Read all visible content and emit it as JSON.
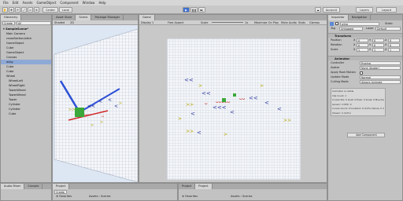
{
  "menu": [
    "File",
    "Edit",
    "Assets",
    "GameObject",
    "Component",
    "Window",
    "Help"
  ],
  "toolbar": {
    "center": "Center",
    "local": "Local",
    "account": "Account",
    "layers": "Layers",
    "layout": "Layout"
  },
  "hierarchy": {
    "tab": "Hierarchy",
    "create": "Create",
    "search_placeholder": "All",
    "scene": "SampleScene*",
    "items": [
      "Main Camera",
      "crossSection/stick",
      "GameObject",
      "Cube",
      "GameObject",
      "Canvas",
      "wing",
      "Cube",
      "Cube",
      "Wheel",
      "WheelLeft",
      "WheelRight",
      "TowerWheel",
      "TowerWheel",
      "Tower",
      "Cylinder",
      "Cylinder",
      "Cube"
    ],
    "selected_index": 6
  },
  "scene_tabs": [
    "Asset Store",
    "Scene",
    "Package Manager"
  ],
  "scene_toolbar": {
    "shading": "Shaded",
    "mode": "2D"
  },
  "game": {
    "tab": "Game",
    "display": "Display 1",
    "aspect": "Free Aspect",
    "scale_label": "Scale",
    "scale_value": "1x",
    "buttons": [
      "Maximize On Play",
      "Mute Audio",
      "Stats",
      "Gizmos"
    ]
  },
  "inspector": {
    "tabs": [
      "Inspector",
      "Navigation"
    ],
    "object_name": "wing",
    "static_label": "Static",
    "tag_label": "Tag",
    "tag_value": "Untagged",
    "layer_label": "Layer",
    "layer_value": "Default",
    "transform": {
      "title": "Transform",
      "rows": [
        {
          "label": "Position",
          "x": "0",
          "y": "0",
          "z": "0"
        },
        {
          "label": "Rotation",
          "x": "0",
          "y": "0",
          "z": "0"
        },
        {
          "label": "Scale",
          "x": "1",
          "y": "1",
          "z": "1"
        }
      ]
    },
    "animator": {
      "title": "Animator",
      "fields": [
        {
          "label": "Controller",
          "value": "flywing"
        },
        {
          "label": "Avatar",
          "value": "None (Avatar)"
        },
        {
          "label": "Apply Root Motion",
          "value": ""
        },
        {
          "label": "Update Mode",
          "value": "Normal"
        },
        {
          "label": "Culling Mode",
          "value": "Always Animate"
        }
      ],
      "info": [
        "Animation is visible",
        "Clip Count: 1",
        "Curves Pos: 0 Quat: 0 Euler: 0 Scale: 0 Muscles: 0",
        "Generic: 0 PPtr: 0",
        "Curves Count: 0 Constant: 0 (0.0%) Dense: 0 (0.0%)",
        "Stream: 0 (0.0%)"
      ]
    },
    "add_component": "Add Component"
  },
  "bottom_left": {
    "tabs": [
      "Audio Mixer",
      "Console"
    ]
  },
  "project": {
    "tab": "Project",
    "create": "Create",
    "favorites": "Favorites",
    "favorite_items": [
      "All Materials",
      "All Models",
      "All Prefabs"
    ],
    "assets": "Assets",
    "breadcrumb": [
      "Assets",
      "Scenes"
    ]
  },
  "project2": {
    "tabs": [
      "Project",
      "Project"
    ],
    "breadcrumb": [
      "Assets",
      "Scenes"
    ]
  },
  "colors": {
    "play_active": "#3d6fd1",
    "selection": "#8fa9d6",
    "scene_bg": "#dde6f3"
  },
  "icons": [
    "play-icon",
    "pause-icon",
    "step-icon",
    "hand-tool-icon",
    "move-tool-icon",
    "rotate-tool-icon",
    "scale-tool-icon",
    "rect-tool-icon",
    "cloud-icon",
    "gear-icon",
    "lock-icon",
    "search-icon",
    "folder-icon",
    "star-icon"
  ]
}
